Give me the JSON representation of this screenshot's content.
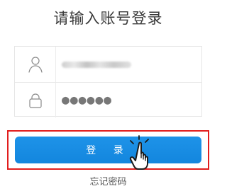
{
  "header": {
    "title": "请输入账号登录"
  },
  "form": {
    "username": {
      "icon": "user-icon",
      "value_obscured": true
    },
    "password": {
      "icon": "lock-icon",
      "masked_value": "●●●●●●"
    }
  },
  "actions": {
    "login_label": "登 录",
    "forgot_label": "忘记密码"
  },
  "colors": {
    "accent": "#1A8FE3",
    "highlight": "#E11D1D",
    "text": "#333333",
    "border": "#E6E6E6"
  }
}
